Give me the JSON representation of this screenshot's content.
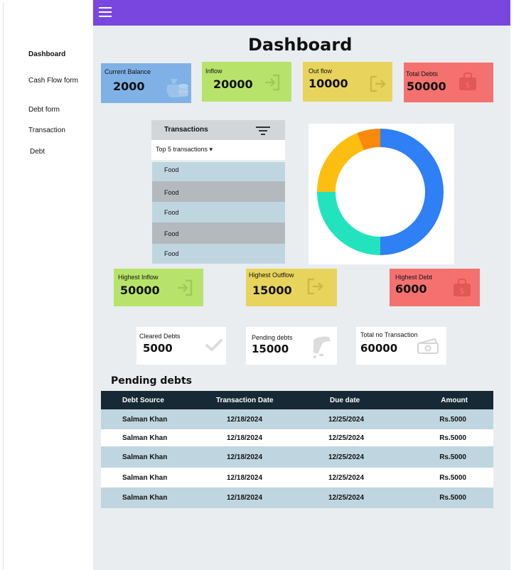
{
  "sidebar": {
    "items": [
      {
        "label": "Dashboard",
        "active": true
      },
      {
        "label": "Cash Flow form"
      },
      {
        "label": "Debt form"
      },
      {
        "label": "Transaction"
      },
      {
        "label": "Debt"
      }
    ]
  },
  "header": {
    "menu_icon": "hamburger-menu-icon",
    "accent": "#7a46e0"
  },
  "page": {
    "title": "Dashboard"
  },
  "summary_cards": [
    {
      "label": "Current Balance",
      "value": "2000",
      "color": "#7fb1e6",
      "icon": "money-bag-icon"
    },
    {
      "label": "Inflow",
      "value": "20000",
      "color": "#b7e36a",
      "icon": "login-arrow-icon"
    },
    {
      "label": "Out flow",
      "value": "10000",
      "color": "#e8d45c",
      "icon": "logout-arrow-icon"
    },
    {
      "label": "Total Debts",
      "value": "50000",
      "color": "#f47170",
      "icon": "dollar-bag-icon"
    }
  ],
  "transactions": {
    "title": "Transactions",
    "filter_icon": "filter-icon",
    "selector": "Top 5 transactions ▾",
    "rows": [
      {
        "label": "Food"
      },
      {
        "label": "Food"
      },
      {
        "label": "Food"
      },
      {
        "label": "Food"
      },
      {
        "label": "Food"
      }
    ]
  },
  "donut_chart": {
    "segments": [
      {
        "share": 0.5,
        "color": "#2f7ff5"
      },
      {
        "share": 0.25,
        "color": "#22e3bd"
      },
      {
        "share": 0.19,
        "color": "#fcbf11"
      },
      {
        "share": 0.06,
        "color": "#fa8a0c"
      }
    ]
  },
  "highlight_cards": [
    {
      "label": "Highest Inflow",
      "value": "50000",
      "color": "#b7e36a",
      "icon": "login-arrow-icon"
    },
    {
      "label": "Highest Outflow",
      "value": "15000",
      "color": "#e8d45c",
      "icon": "logout-arrow-icon"
    },
    {
      "label": "Highest Debt",
      "value": "6000",
      "color": "#f47170",
      "icon": "dollar-bag-icon"
    }
  ],
  "stat_cards": [
    {
      "label": "Cleared Debts",
      "value": "5000",
      "icon": "checkmark-icon"
    },
    {
      "label": "Pending debts",
      "value": "15000",
      "icon": "hand-coin-icon"
    },
    {
      "label": "Total no Transaction",
      "value": "60000",
      "icon": "cash-icon"
    }
  ],
  "pending_debts": {
    "title": "Pending debts",
    "columns": [
      "Debt Source",
      "Transaction Date",
      "Due date",
      "Amount"
    ],
    "rows": [
      [
        "Salman Khan",
        "12/18/2024",
        "12/25/2024",
        "Rs.5000"
      ],
      [
        "Salman Khan",
        "12/18/2024",
        "12/25/2024",
        "Rs.5000"
      ],
      [
        "Salman Khan",
        "12/18/2024",
        "12/25/2024",
        "Rs.5000"
      ],
      [
        "Salman Khan",
        "12/18/2024",
        "12/25/2024",
        "Rs.5000"
      ],
      [
        "Salman Khan",
        "12/18/2024",
        "12/25/2024",
        "Rs.5000"
      ]
    ]
  }
}
